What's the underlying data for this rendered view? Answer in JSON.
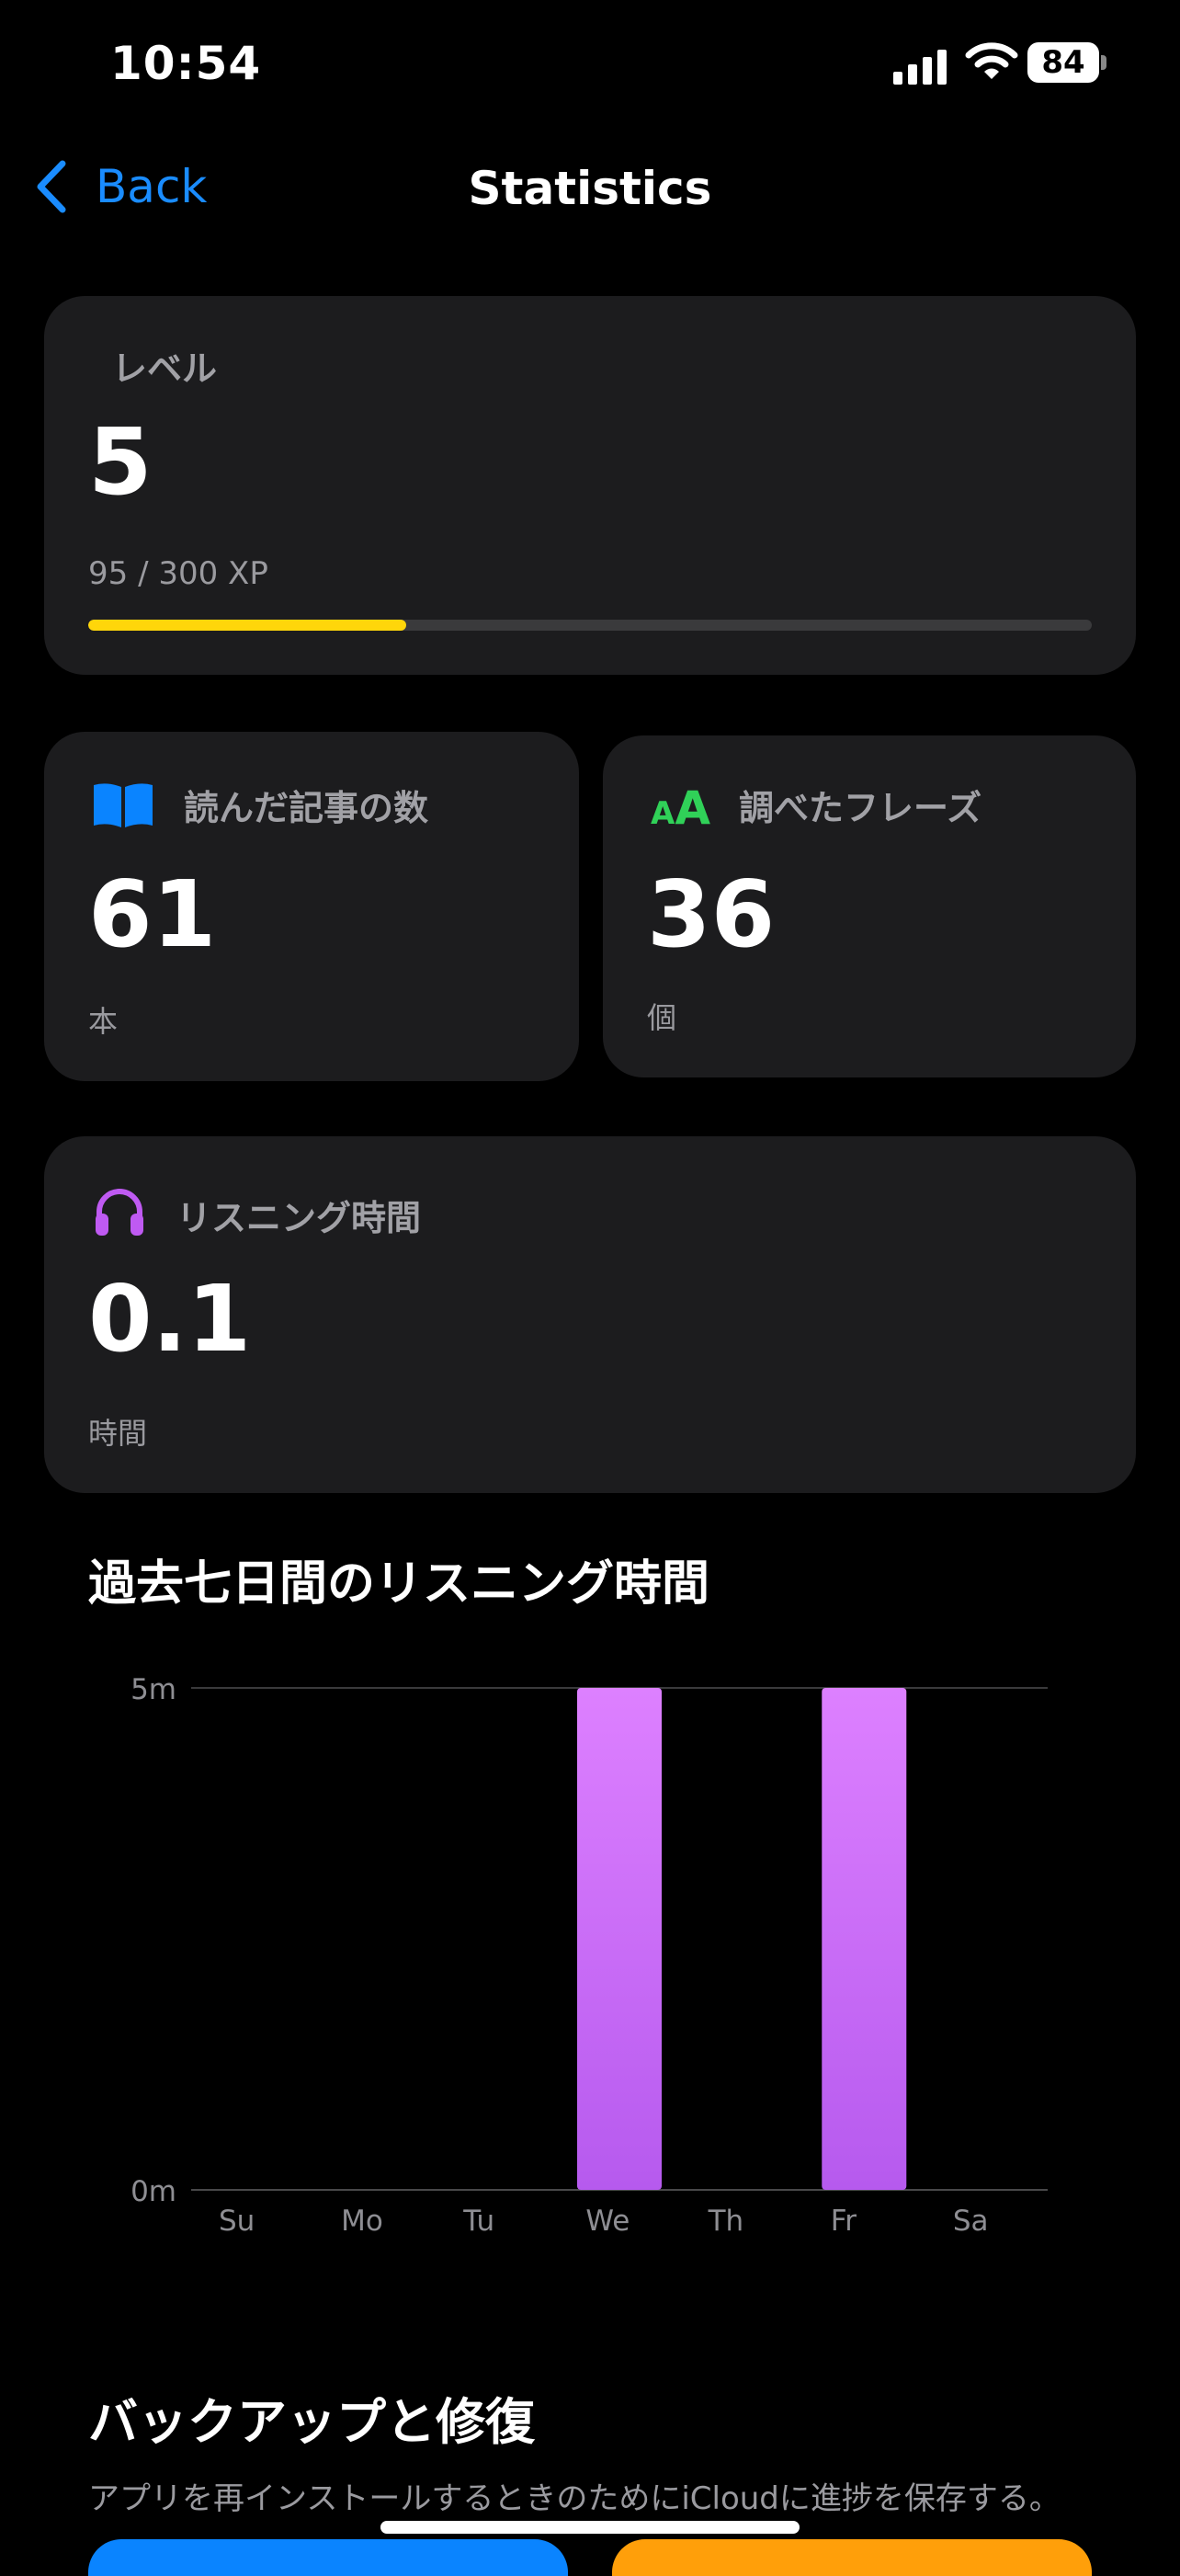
{
  "status_bar": {
    "time": "10:54",
    "battery": "84"
  },
  "nav": {
    "back_label": "Back",
    "title": "Statistics"
  },
  "level_card": {
    "label": "レベル",
    "value": "5",
    "xp_text": "95 / 300 XP",
    "xp_progress": 0.3167,
    "progress_color": "#ffd60a"
  },
  "articles_card": {
    "icon": "book-icon",
    "label": "読んだ記事の数",
    "value": "61",
    "unit": "本",
    "icon_color": "#0a84ff"
  },
  "phrases_card": {
    "icon": "text-size-icon",
    "icon_text": "AA",
    "label": "調べたフレーズ",
    "value": "36",
    "unit": "個",
    "icon_color": "#30d158"
  },
  "listening_card": {
    "icon": "headphones-icon",
    "label": "リスニング時間",
    "value": "0.1",
    "unit": "時間",
    "icon_color": "#bf5af2"
  },
  "chart_section": {
    "title": "過去七日間のリスニング時間"
  },
  "chart_data": {
    "type": "bar",
    "categories": [
      "Su",
      "Mo",
      "Tu",
      "We",
      "Th",
      "Fr",
      "Sa"
    ],
    "values": [
      0,
      0,
      0,
      5,
      0,
      5,
      0
    ],
    "ylim": [
      0,
      5
    ],
    "y_ticks": [
      "0m",
      "5m"
    ],
    "bar_color_top": "#dd80ff",
    "bar_color_bottom": "#b65aee",
    "grid": true
  },
  "backup_section": {
    "title": "バックアップと修復",
    "description": "アプリを再インストールするときのためにiCloudに進捗を保存する。"
  }
}
